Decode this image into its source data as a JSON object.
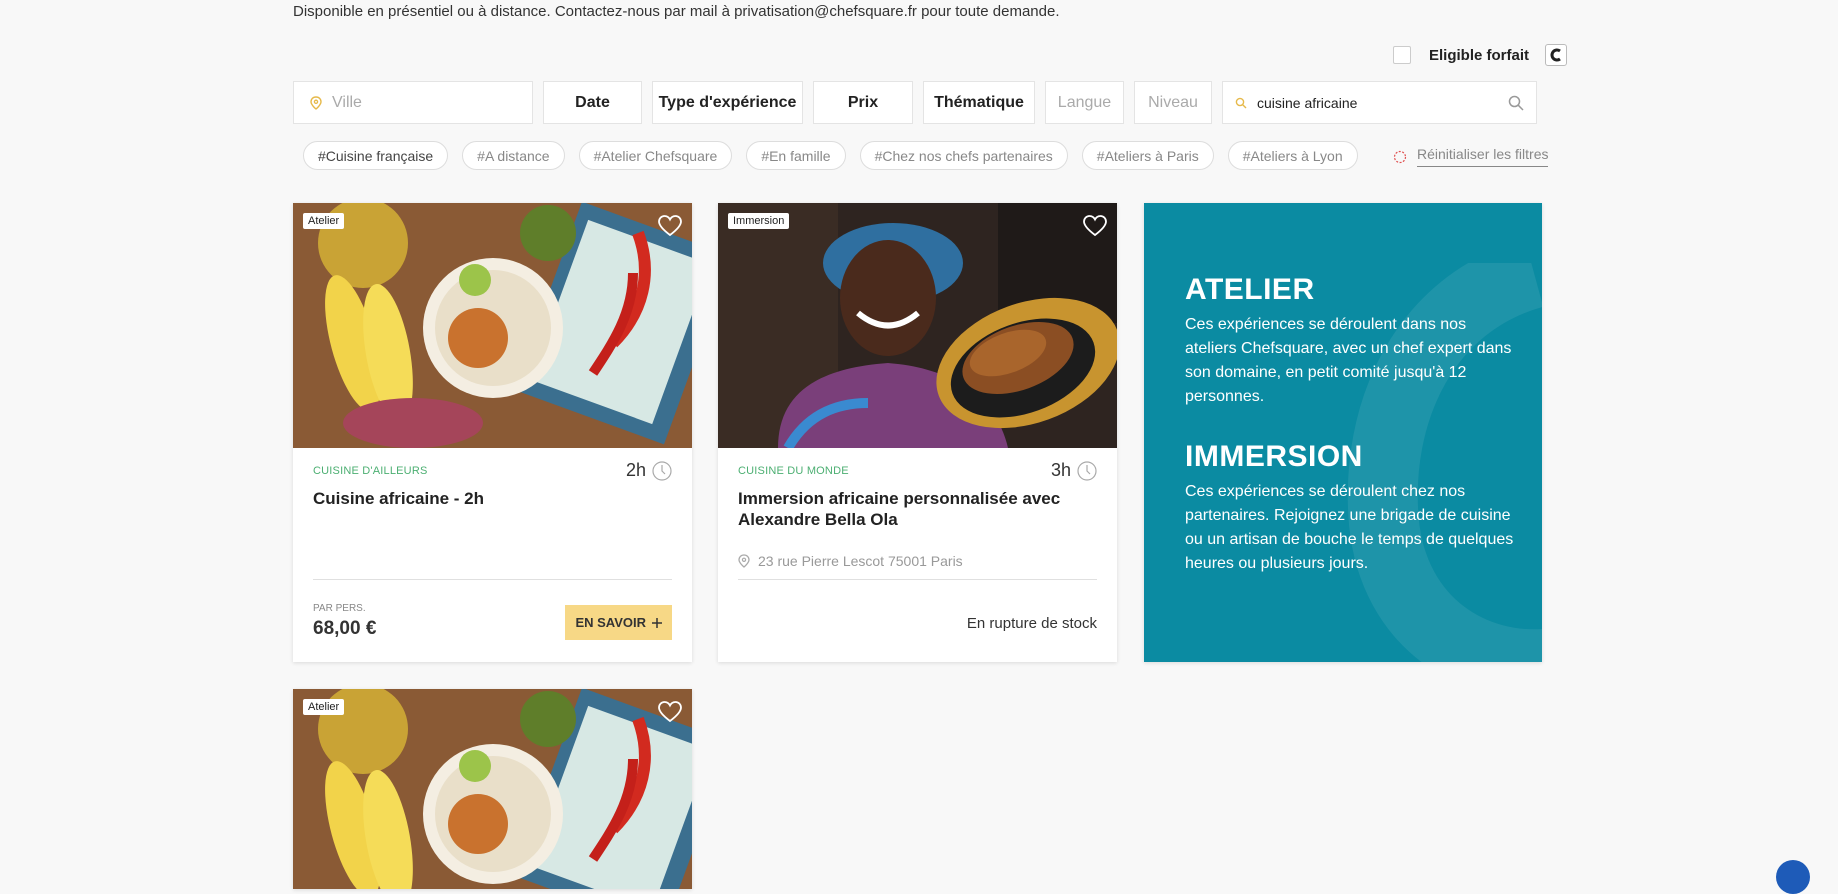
{
  "header": {
    "note": "Disponible en présentiel ou à distance. Contactez-nous par mail à privatisation@chefsquare.fr pour toute demande.",
    "forfait_label": "Eligible forfait"
  },
  "filters": {
    "ville_placeholder": "Ville",
    "date": "Date",
    "type": "Type d'expérience",
    "prix": "Prix",
    "thematique": "Thématique",
    "langue": "Langue",
    "niveau": "Niveau",
    "search_value": "cuisine africaine"
  },
  "tags": [
    "#Cuisine française",
    "#A distance",
    "#Atelier Chefsquare",
    "#En famille",
    "#Chez nos chefs partenaires",
    "#Ateliers à Paris",
    "#Ateliers à Lyon"
  ],
  "reset_label": "Réinitialiser les filtres",
  "cards": [
    {
      "badge": "Atelier",
      "category": "CUISINE D'AILLEURS",
      "duration": "2h",
      "title": "Cuisine africaine - 2h",
      "price_label": "PAR PERS.",
      "price": "68,00 €",
      "button": "EN SAVOIR"
    },
    {
      "badge": "Immersion",
      "category": "CUISINE DU MONDE",
      "duration": "3h",
      "title": "Immersion africaine personnalisée avec Alexandre Bella Ola",
      "address": "23 rue Pierre Lescot 75001 Paris",
      "stock": "En rupture de stock"
    },
    {
      "badge": "Atelier"
    }
  ],
  "info": {
    "atelier_title": "ATELIER",
    "atelier_text": "Ces expériences se déroulent dans nos ateliers Chefsquare, avec un chef expert dans son domaine, en petit comité jusqu'à 12 personnes.",
    "immersion_title": "IMMERSION",
    "immersion_text": "Ces expériences se déroulent chez nos partenaires. Rejoignez une brigade de cuisine ou un artisan de bouche le temps de quelques heures ou plusieurs jours."
  },
  "colors": {
    "accent_teal": "#0b8ba2",
    "button_yellow": "#f7d886",
    "category_green": "#4caf72"
  }
}
